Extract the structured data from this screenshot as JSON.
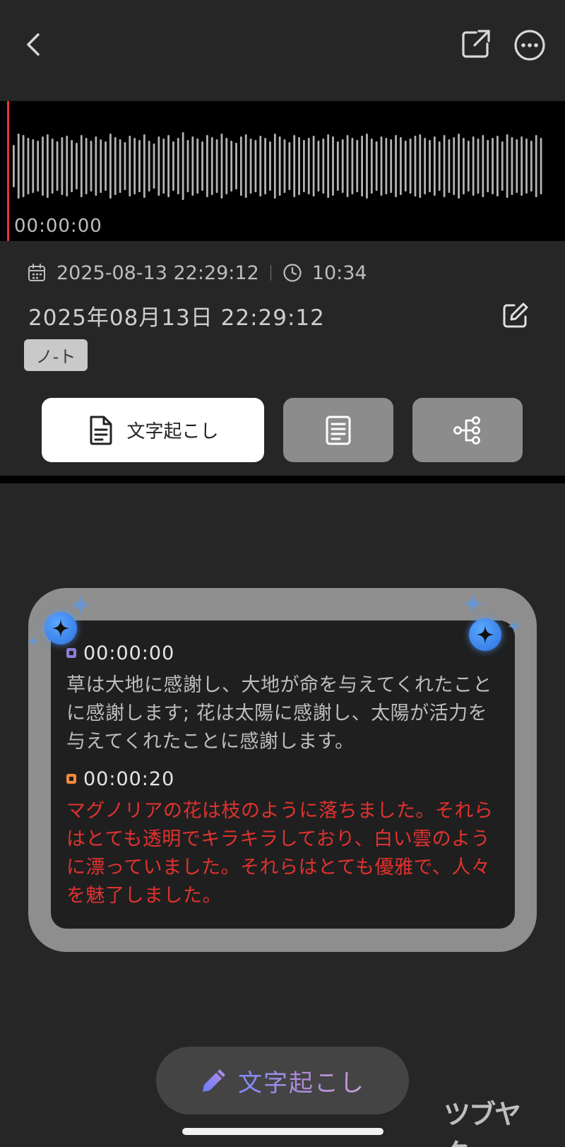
{
  "topbar": {
    "back_icon": "chevron-left-icon",
    "share_icon": "external-share-icon",
    "more_icon": "more-horizontal-icon"
  },
  "waveform": {
    "current_time": "00:00:00",
    "playhead_color": "#e53935"
  },
  "meta": {
    "date": "2025-08-13 22:29:12",
    "duration": "10:34"
  },
  "recording": {
    "title": "2025年08月13日 22:29:12",
    "tag": "ノ-ト"
  },
  "tabs": {
    "transcript_label": "文字起こし",
    "summary_icon": "document-lines-icon",
    "mindmap_icon": "mind-map-icon"
  },
  "transcript": {
    "segments": [
      {
        "time": "00:00:00",
        "text": "草は大地に感謝し、大地が命を与えてくれたことに感謝します; 花は太陽に感謝し、太陽が活力を与えてくれたことに感謝します。",
        "color": "#bdbdbd",
        "dot_color": "#8a7fd6"
      },
      {
        "time": "00:00:20",
        "text": "マグノリアの花は枝のように落ちました。それらはとても透明でキラキラしており、白い雲のように漂っていました。それらはとても優雅で、人々を魅了しました。",
        "color": "#e0322f",
        "dot_color": "#f08a3c"
      }
    ]
  },
  "fab": {
    "label": "文字起こし",
    "icon": "pencil-icon"
  },
  "watermark": "ツブヤク。"
}
